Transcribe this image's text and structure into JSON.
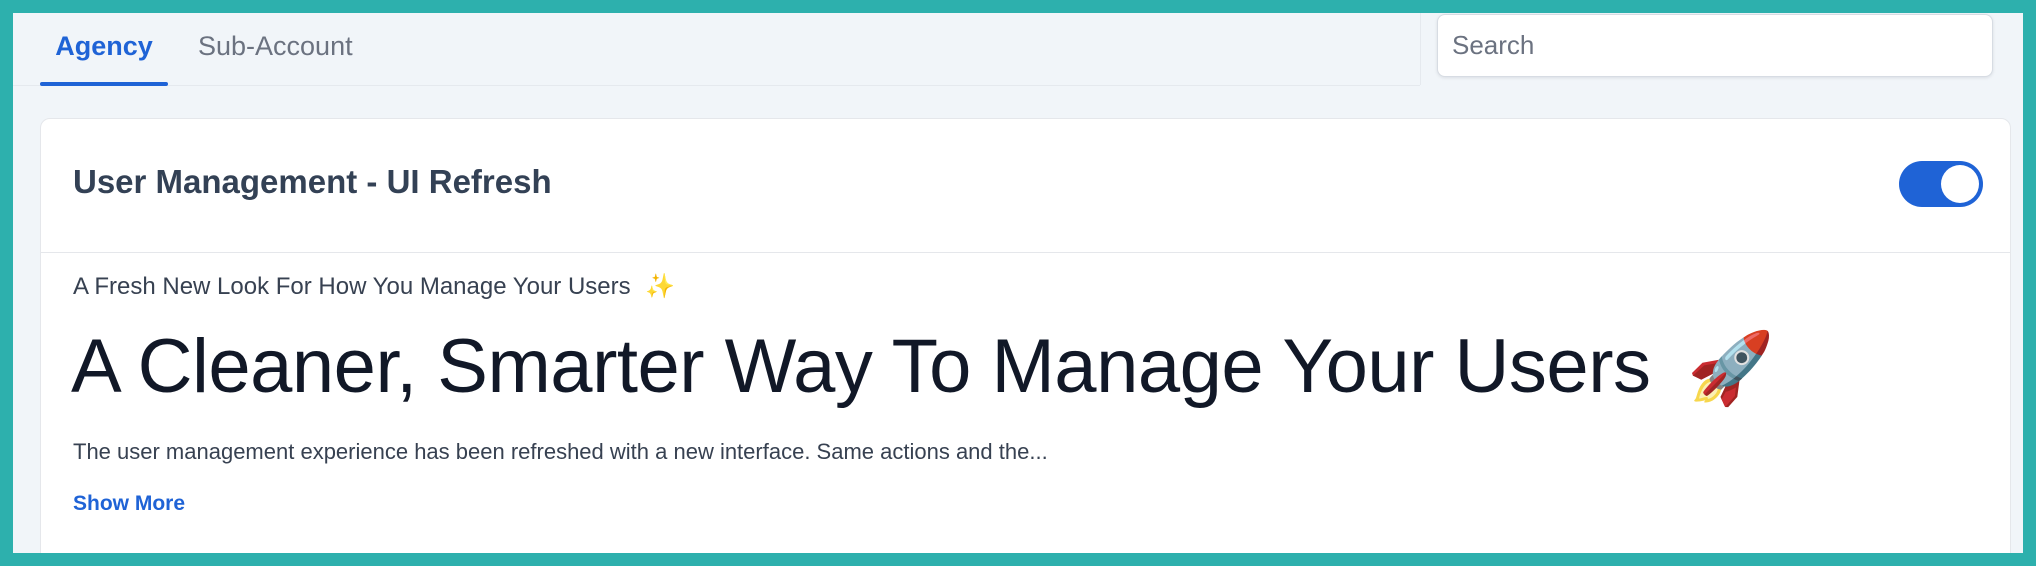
{
  "tabs": [
    {
      "label": "Agency",
      "active": true
    },
    {
      "label": "Sub-Account",
      "active": false
    }
  ],
  "search": {
    "placeholder": "Search",
    "value": ""
  },
  "feature": {
    "title": "User Management - UI Refresh",
    "toggle_on": true,
    "subtitle": "A Fresh New Look For How You Manage Your Users",
    "subtitle_emoji": "✨",
    "headline": "A Cleaner, Smarter Way To Manage Your Users",
    "headline_emoji": "🚀",
    "description": "The user management experience has been refreshed with a new interface. Same actions and the...",
    "show_more_label": "Show More"
  },
  "colors": {
    "accent": "#1f63d6",
    "frame": "#2db0ad",
    "page_bg": "#f1f5f9"
  }
}
